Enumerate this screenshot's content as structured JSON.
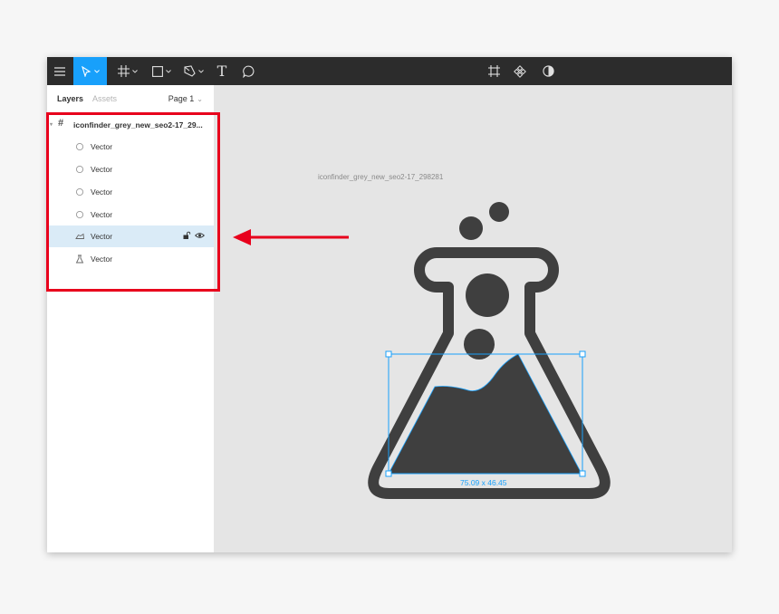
{
  "toolbar": {
    "items": [
      "menu-icon",
      "move-tool-icon",
      "frame-tool-icon",
      "shape-tool-icon",
      "pen-tool-icon",
      "text-tool-icon",
      "comment-tool-icon",
      "create-component-icon",
      "components-icon",
      "mask-icon"
    ],
    "text_tool_glyph": "T",
    "active_tool": "move-tool"
  },
  "sidebar": {
    "tabs": {
      "layers": "Layers",
      "assets": "Assets"
    },
    "page": "Page 1",
    "layers": {
      "frame": "iconfinder_grey_new_seo2-17_29...",
      "items": [
        {
          "label": "Vector",
          "icon": "ellipse-icon"
        },
        {
          "label": "Vector",
          "icon": "ellipse-icon"
        },
        {
          "label": "Vector",
          "icon": "ellipse-icon"
        },
        {
          "label": "Vector",
          "icon": "ellipse-icon"
        },
        {
          "label": "Vector",
          "icon": "vector-triangle-icon",
          "selected": true
        },
        {
          "label": "Vector",
          "icon": "vector-flask-icon"
        }
      ]
    }
  },
  "canvas": {
    "frame_label": "iconfinder_grey_new_seo2-17_298281",
    "selection_dims": "75.09 x 46.45"
  },
  "colors": {
    "accent": "#18a0fb",
    "toolbar": "#2c2c2c",
    "canvas": "#e5e5e5",
    "icon": "#3f3f3f",
    "annotation": "#e8001c"
  }
}
